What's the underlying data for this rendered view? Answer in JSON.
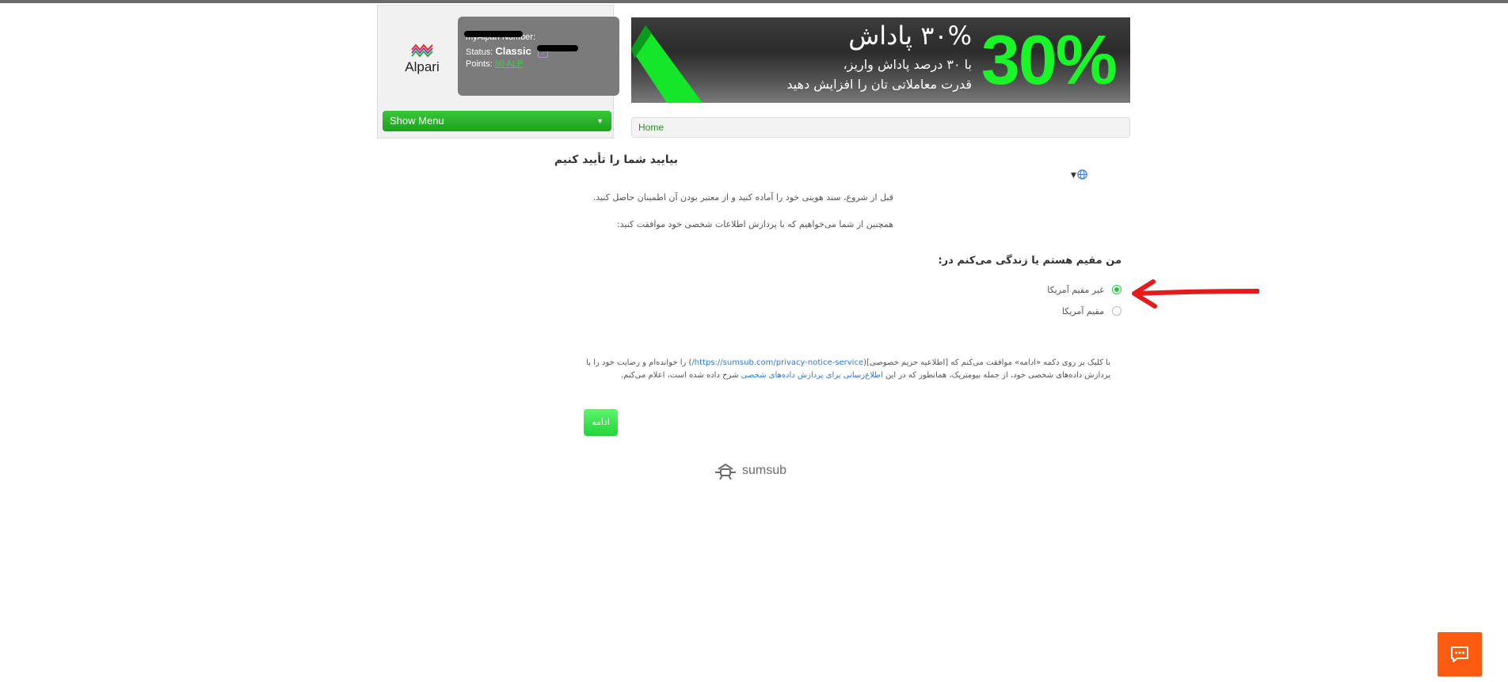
{
  "account": {
    "logo_text": "Alpari",
    "number_label": "myAlpari Number:",
    "status_label": "Status:",
    "status_value": "Classic",
    "points_label": "Points:",
    "points_value": "50 ALP",
    "show_menu_label": "Show Menu",
    "show_menu_arrow": "▼"
  },
  "banner": {
    "percent": "30%",
    "title": "۳۰% پاداش",
    "line1": "با ۳۰ درصد پاداش واریز،",
    "line2": "قدرت معاملاتی تان را افزایش دهید"
  },
  "breadcrumb": {
    "home": "Home"
  },
  "verification": {
    "title": "بیایید شما را تأیید کنیم",
    "intro_1": "قبل از شروع، سند هویتی خود را آماده کنید و از معتبر بودن آن اطمینان حاصل کنید.",
    "intro_2": "همچنین از شما می‌خواهیم که با پردازش اطلاعات شخصی خود موافقت کنید:",
    "residence_title": "من مقیم هستم یا زندگی می‌کنم در:",
    "options": [
      {
        "label": "غیر مقیم آمریکا",
        "checked": true
      },
      {
        "label": "مقیم آمریکا",
        "checked": false
      }
    ],
    "consent_part1": "با کلیک بر روی دکمه «ادامه» موافقت می‌کنم که [اطلاعیه حریم خصوصی](",
    "consent_link": "https://sumsub.com/privacy-notice-service/",
    "consent_part2": ") را خوانده‌ام و رضایت خود را با پردازش داده‌های شخصی خود، از جمله بیومتریک، همانطور که در این ",
    "consent_link2": "اطلاع‌رسانی برای پردازش داده‌های شخصی",
    "consent_part3": " شرح داده شده است، اعلام می‌کنم.",
    "continue_label": "ادامه"
  },
  "footer": {
    "brand": "sumsub"
  },
  "colors": {
    "brand_green": "#1f9e22",
    "accent_orange": "#fc5a0e",
    "link_blue": "#2e7bd6",
    "annotation_red": "#e41b1b"
  }
}
